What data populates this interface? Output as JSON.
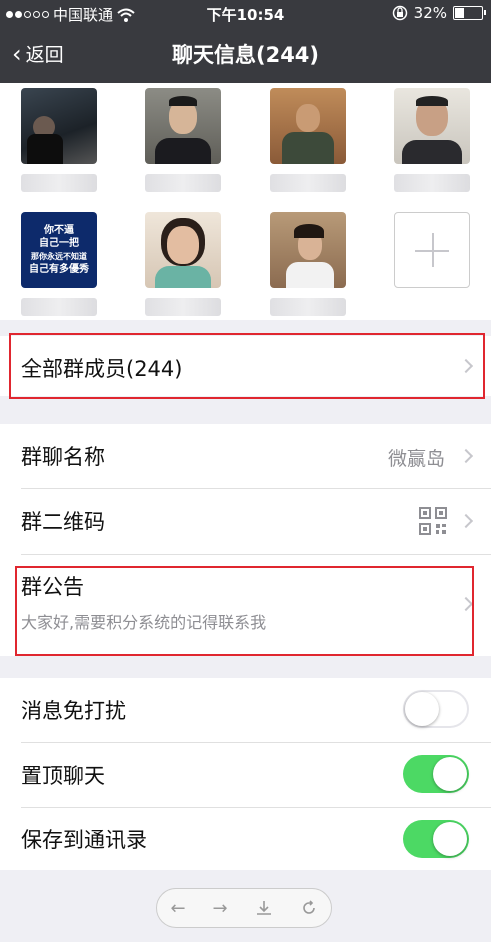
{
  "status": {
    "carrier": "中国联通",
    "time": "下午10:54",
    "battery": "32%"
  },
  "nav": {
    "back_label": "返回",
    "title": "聊天信息(244)"
  },
  "members": [
    {
      "kind": "photo-dark"
    },
    {
      "kind": "photo-man1"
    },
    {
      "kind": "photo-man2"
    },
    {
      "kind": "photo-man3"
    },
    {
      "kind": "poster",
      "lines": [
        "你不逼",
        "自己一把",
        "那你永远不知道",
        "自己有多優秀"
      ]
    },
    {
      "kind": "photo-woman1"
    },
    {
      "kind": "photo-woman2"
    }
  ],
  "cells": {
    "all_members": "全部群成员(244)",
    "group_name_label": "群聊名称",
    "group_name_value": "微赢岛",
    "qr_label": "群二维码",
    "notice_label": "群公告",
    "notice_text": "大家好,需要积分系统的记得联系我",
    "mute_label": "消息免打扰",
    "pin_label": "置顶聊天",
    "save_label": "保存到通讯录"
  },
  "toggles": {
    "mute": false,
    "pin": true,
    "save": true
  },
  "colors": {
    "accent_green": "#4cd964",
    "highlight_red": "#e0262f",
    "nav_bg": "#393a3f"
  }
}
